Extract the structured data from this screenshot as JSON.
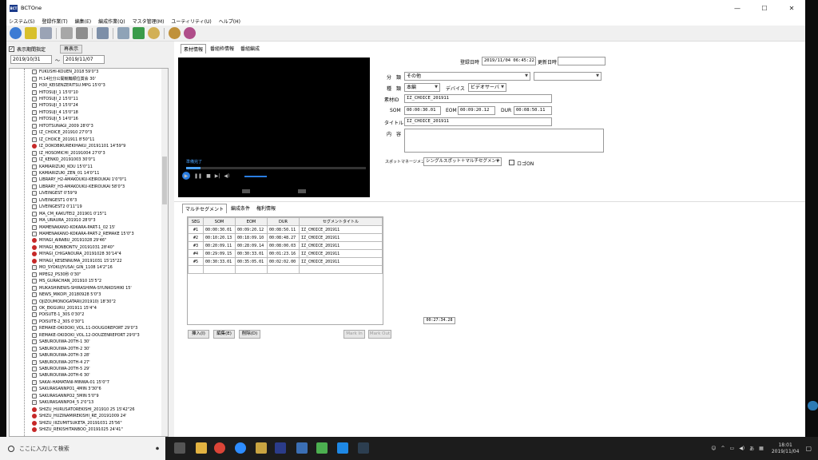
{
  "window": {
    "title": "BCTOne",
    "app_icon_text": "BCT",
    "min": "—",
    "max": "☐",
    "close": "✕"
  },
  "menu": [
    "システム(S)",
    "登録作業(T)",
    "編集(E)",
    "編成作業(Q)",
    "マスタ管理(M)",
    "ユーティリティ(U)",
    "ヘルプ(H)"
  ],
  "filter": {
    "checkbox_label": "表示期間指定",
    "checked": "✓",
    "refresh": "再表示",
    "date_from": "2019/10/31",
    "tilde": "～",
    "date_to": "2019/11/07"
  },
  "tree_items": [
    {
      "text": "FUKUSHI-KOUEN_2018 59'0\"3",
      "kind": "file"
    },
    {
      "text": "H.14社分公開競輪順位賞会 30'",
      "kind": "file"
    },
    {
      "text": "H30_KEISENZERITSU.MPG 15'0\"3",
      "kind": "file"
    },
    {
      "text": "HITOSUJI_1 15'0\"10",
      "kind": "file"
    },
    {
      "text": "HITOSUJI_2 15'0\"11",
      "kind": "file"
    },
    {
      "text": "HITOSUJI_3 15'0\"24",
      "kind": "file"
    },
    {
      "text": "HITOSUJI_4 15'0\"18",
      "kind": "file"
    },
    {
      "text": "HITOSUJI_5 14'0\"16",
      "kind": "file"
    },
    {
      "text": "HITOTSUNAGI_2009 28'0\"3",
      "kind": "file"
    },
    {
      "text": "IZ_CHOICE_201910 27'0\"3",
      "kind": "file"
    },
    {
      "text": "IZ_CHOICE_201911 8'50\"11",
      "kind": "file"
    },
    {
      "text": "IZ_DOKOBIKUREKIHAKU_20191101 14'59\"9",
      "kind": "rec"
    },
    {
      "text": "IZ_HOSOMICHI_20191004 27'0\"3",
      "kind": "file"
    },
    {
      "text": "IZ_KENKO_20191003 30'0\"1",
      "kind": "file"
    },
    {
      "text": "KAMIARIZUKI_KOU 15'0\"11",
      "kind": "file"
    },
    {
      "text": "KAMIARIZUKI_ZEN_01 14'0\"11",
      "kind": "file"
    },
    {
      "text": "LIBRARY_H2-AMAKOUKU-KEIROUKAI 1'0\"0\"1",
      "kind": "file"
    },
    {
      "text": "LIBRARY_H3-AMAKOUKU-KEIROUKAI 58'0\"3",
      "kind": "file"
    },
    {
      "text": "LIVEINGEST 0'59\"9",
      "kind": "file"
    },
    {
      "text": "LIVEINGEST1 0'6\"3",
      "kind": "file"
    },
    {
      "text": "LIVEINGEST2 0'11\"19",
      "kind": "file"
    },
    {
      "text": "MA_CM_KAKUTEI2_201901 0'15\"1",
      "kind": "file"
    },
    {
      "text": "MA_URAURA_201910 28'0\"3",
      "kind": "file"
    },
    {
      "text": "MAMENAKANO-KOKARA-PART-1_02 15'",
      "kind": "file"
    },
    {
      "text": "MAMENAKANO-KOKARA-PART-2_REMAKE 15'0\"3",
      "kind": "file"
    },
    {
      "text": "MIYAGI_AIRABU_20191028 29'46\"",
      "kind": "rec"
    },
    {
      "text": "MIYAGI_BONBONTV_20191031 28'40\"",
      "kind": "rec"
    },
    {
      "text": "MIYAGI_CHIGANOURA_20191028 30'14\"4",
      "kind": "rec"
    },
    {
      "text": "MIYAGI_KESENNUMA_20191031 15'15\"22",
      "kind": "rec"
    },
    {
      "text": "MO_SYOKUJYUSAI_GIN_1108 14'2\"16",
      "kind": "file"
    },
    {
      "text": "MPEG2_PS30秒 0'30\"",
      "kind": "file"
    },
    {
      "text": "MS_GURACHAN_201910 15'5\"2",
      "kind": "file"
    },
    {
      "text": "MUKASHINEWS-SHIRASHIMA-SYUNKOSHIKI 15'",
      "kind": "file"
    },
    {
      "text": "NEWS_MIKOPI_20180928 5'0\"3",
      "kind": "file"
    },
    {
      "text": "OJIZOUMONOGATARI(201910) 18'30\"2",
      "kind": "file"
    },
    {
      "text": "OK_EKIGURU_201911 15'4\"4",
      "kind": "file"
    },
    {
      "text": "POISUTE-1_30S 0'30\"2",
      "kind": "file"
    },
    {
      "text": "POISUTE-2_30S 0'30\"1",
      "kind": "file"
    },
    {
      "text": "REMAKE-OKIDOKI_VOL.11-DOUGOREPORT 29'0\"3",
      "kind": "file"
    },
    {
      "text": "REMAKE-OKIDOKI_VOL.12-DOUZENREPORT 29'0\"3",
      "kind": "file"
    },
    {
      "text": "SABUROUIWA-20TH-1 30'",
      "kind": "file"
    },
    {
      "text": "SABUROUIWA-20TH-2 30'",
      "kind": "file"
    },
    {
      "text": "SABUROUIWA-20TH-3 28'",
      "kind": "file"
    },
    {
      "text": "SABUROUIWA-20TH-4 27'",
      "kind": "file"
    },
    {
      "text": "SABUROUIWA-20TH-5 29'",
      "kind": "file"
    },
    {
      "text": "SABUROUIWA-20TH-6 30'",
      "kind": "file"
    },
    {
      "text": "SAKAI-HAMATANI-MINWA-01 15'0\"7",
      "kind": "file"
    },
    {
      "text": "SAKURASANNPO1_4MIN 3'30\"6",
      "kind": "file"
    },
    {
      "text": "SAKURASANNPO2_5MIN 5'0\"9",
      "kind": "file"
    },
    {
      "text": "SAKURASANNPO4_5 2'0\"13",
      "kind": "file"
    },
    {
      "text": "SHIZU_HURUSATOREKISHI_201910 25 15'42\"26",
      "kind": "rec"
    },
    {
      "text": "SHIZU_HUZINAMIREKISHI_RE_20191009 24'",
      "kind": "rec"
    },
    {
      "text": "SHIZU_IIIZUMITSUKETA_20191031 25'56\"",
      "kind": "rec"
    },
    {
      "text": "SHIZU_REKISHITANBOO_20191025 24'41\"",
      "kind": "rec"
    }
  ],
  "top_tabs": [
    "素材情報",
    "番組枠情報",
    "番組編成"
  ],
  "video": {
    "status": "準備完了",
    "progress": 0.08
  },
  "form": {
    "reg_date_label": "登録日時",
    "reg_date": "2019/11/04 06:45:22",
    "upd_date_label": "更新日時",
    "upd_date": "",
    "bunrui_label": "分　類",
    "bunrui": "その他",
    "shubetsu_label": "種　類",
    "shubetsu": "本編",
    "device_label": "デバイス",
    "device": "ビデオサーバ",
    "id_label": "素材ID",
    "id": "IZ_CHOICE_201911",
    "som_label": "SOM",
    "som": "00:00:30.01",
    "eom_label": "EOM",
    "eom": "00:09:20.12",
    "dur_label": "DUR",
    "dur": "00:08:50.11",
    "title_label": "タイトル",
    "title": "IZ_CHOICE_201911",
    "content_label": "内　容",
    "content": "",
    "spot_label": "スポットマネージメント",
    "spot": "シングルスポット＋マルチセグメント",
    "logo_label": "ロゴON"
  },
  "bottom_tabs": [
    "マルチセグメント",
    "編成条件",
    "権利情報"
  ],
  "segments": {
    "headers": [
      "SEG",
      "SOM",
      "EOM",
      "DUR",
      "セグメントタイトル"
    ],
    "rows": [
      [
        "#1",
        "00:00:30.01",
        "00:09:20.12",
        "00:08:50.11",
        "IZ_CHOICE_201911"
      ],
      [
        "#2",
        "00:10:20.13",
        "00:18:09.10",
        "00:08:48.27",
        "IZ_CHOICE_201911"
      ],
      [
        "#3",
        "00:20:09.11",
        "00:28:09.14",
        "00:08:00.03",
        "IZ_CHOICE_201911"
      ],
      [
        "#4",
        "00:29:09.15",
        "00:30:33.01",
        "00:01:23.16",
        "IZ_CHOICE_201911"
      ],
      [
        "#5",
        "00:30:33.01",
        "00:35:05.01",
        "00:02:02.00",
        "IZ_CHOICE_201911"
      ]
    ],
    "total": "00:27:34.28"
  },
  "seg_buttons": {
    "insert": "挿入(I)",
    "edit": "編集(E)",
    "delete": "削除(D)",
    "mark_in": "Mark In",
    "mark_out": "Mark Out"
  },
  "taskbar": {
    "search": "ここに入力して検索",
    "ime": "あ",
    "time": "18:01",
    "date": "2019/11/04"
  }
}
